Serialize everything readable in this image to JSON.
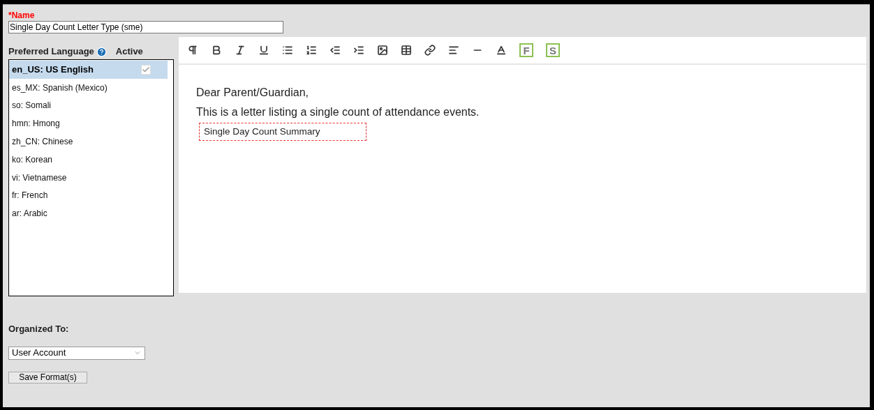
{
  "name_field": {
    "required_mark": "*",
    "label": "Name",
    "value": "Single Day Count Letter Type (sme)"
  },
  "languages": {
    "heading": "Preferred Language",
    "active_heading": "Active",
    "items": [
      {
        "label": "en_US: US English",
        "selected": true,
        "active": true
      },
      {
        "label": "es_MX: Spanish (Mexico)",
        "selected": false
      },
      {
        "label": "so: Somali",
        "selected": false
      },
      {
        "label": "hmn: Hmong",
        "selected": false
      },
      {
        "label": "zh_CN: Chinese",
        "selected": false
      },
      {
        "label": "ko: Korean",
        "selected": false
      },
      {
        "label": "vi: Vietnamese",
        "selected": false
      },
      {
        "label": "fr: French",
        "selected": false
      },
      {
        "label": "ar: Arabic",
        "selected": false
      }
    ]
  },
  "editor": {
    "toolbar": [
      {
        "kind": "paragraph"
      },
      {
        "kind": "bold"
      },
      {
        "kind": "italic"
      },
      {
        "kind": "underline"
      },
      {
        "kind": "bullets"
      },
      {
        "kind": "numbers"
      },
      {
        "kind": "outdent"
      },
      {
        "kind": "indent"
      },
      {
        "kind": "image"
      },
      {
        "kind": "table"
      },
      {
        "kind": "link"
      },
      {
        "kind": "align"
      },
      {
        "kind": "rule"
      },
      {
        "kind": "color"
      },
      {
        "kind": "field",
        "label": "F"
      },
      {
        "kind": "field",
        "label": "S"
      }
    ],
    "lines": [
      "Dear Parent/Guardian,",
      "This is a letter listing a single count of attendance events."
    ],
    "placeholder_block": "Single Day Count Summary"
  },
  "organized_to": {
    "label": "Organized To:",
    "value": "User Account"
  },
  "save_button": "Save Format(s)"
}
